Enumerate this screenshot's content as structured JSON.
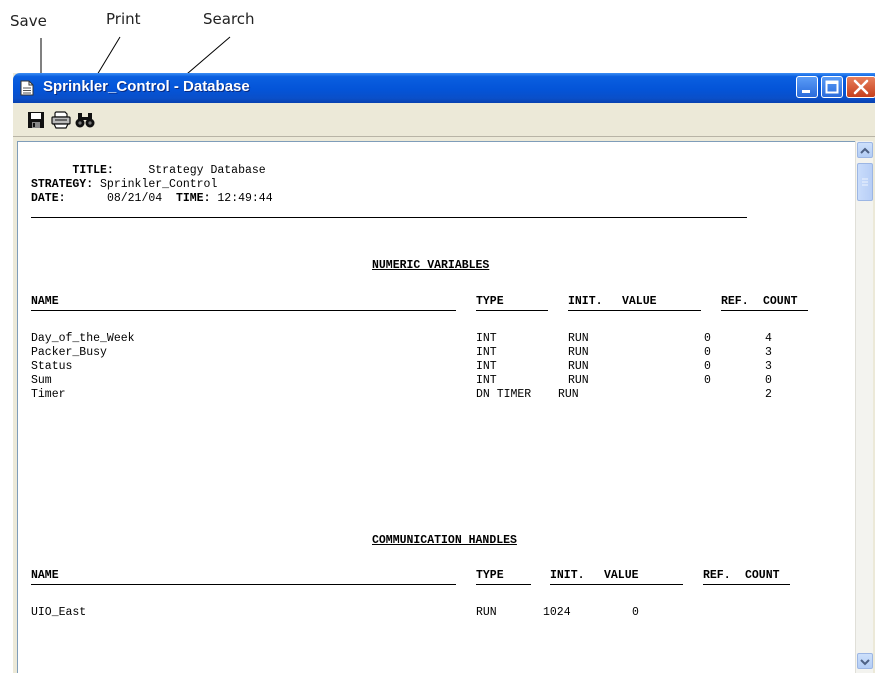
{
  "callouts": {
    "save": "Save",
    "print": "Print",
    "search": "Search"
  },
  "window": {
    "title": "Sprinkler_Control - Database"
  },
  "toolbar": {
    "save_icon": "floppy-disk-icon",
    "print_icon": "printer-icon",
    "search_icon": "binoculars-icon"
  },
  "report": {
    "header": {
      "title_label": "TITLE:",
      "title_value": "Strategy Database",
      "strategy_label": "STRATEGY:",
      "strategy_value": "Sprinkler_Control",
      "date_label": "DATE:",
      "date_value": "08/21/04",
      "time_label": "TIME:",
      "time_value": "12:49:44"
    },
    "numeric": {
      "heading": "NUMERIC VARIABLES",
      "columns": {
        "name": "NAME",
        "type": "TYPE",
        "init": "INIT.",
        "value": "VALUE",
        "ref": "REF.",
        "count": "COUNT"
      },
      "rows": [
        {
          "name": "Day_of_the_Week",
          "type": "INT",
          "init": "RUN",
          "value": "0",
          "count": "4"
        },
        {
          "name": "Packer_Busy",
          "type": "INT",
          "init": "RUN",
          "value": "0",
          "count": "3"
        },
        {
          "name": "Status",
          "type": "INT",
          "init": "RUN",
          "value": "0",
          "count": "3"
        },
        {
          "name": "Sum",
          "type": "INT",
          "init": "RUN",
          "value": "0",
          "count": "0"
        },
        {
          "name": "Timer",
          "type": "DN TIMER",
          "init": "RUN",
          "value": "",
          "count": "2"
        }
      ]
    },
    "comm": {
      "heading": "COMMUNICATION HANDLES",
      "columns": {
        "name": "NAME",
        "type": "TYPE",
        "init": "INIT.",
        "value": "VALUE",
        "ref": "REF.",
        "count": "COUNT"
      },
      "rows": [
        {
          "name": "UIO_East",
          "type": "RUN",
          "init": "1024",
          "value": "0"
        }
      ]
    }
  },
  "colors": {
    "titlebar": "#0454d8",
    "close": "#c53f1d",
    "chrome": "#ece9d8"
  }
}
